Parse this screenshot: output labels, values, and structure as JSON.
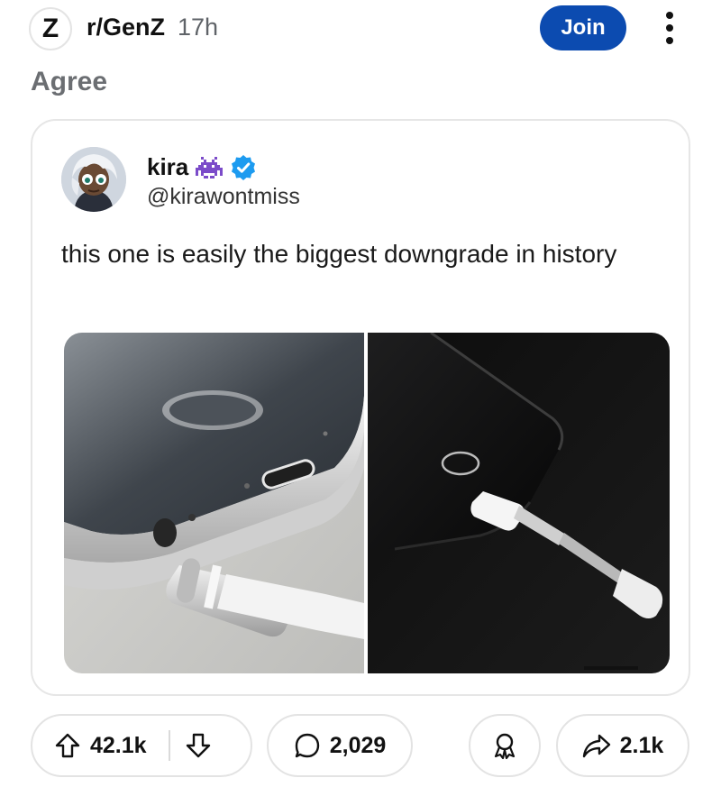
{
  "header": {
    "subreddit_letter": "Z",
    "subreddit": "r/GenZ",
    "time": "17h",
    "join_label": "Join",
    "more_icon": "more-vertical-icon"
  },
  "post": {
    "title": "Agree"
  },
  "tweet": {
    "display_name": "kira",
    "handle": "@kirawontmiss",
    "text": "this one is easily the biggest downgrade in history",
    "name_emoji_icon": "space-invader-icon",
    "verified_icon": "verified-badge-icon",
    "verified_color": "#1d9bf0",
    "media": {
      "left_image": "silver iPhone with headphone jack and 3.5mm audio plug",
      "right_image": "black iPhone with lightning to headphone adapter"
    }
  },
  "actions": {
    "upvotes": "42.1k",
    "comments": "2,029",
    "shares": "2.1k",
    "upvote_icon": "arrow-up-icon",
    "downvote_icon": "arrow-down-icon",
    "comment_icon": "comment-bubble-icon",
    "award_icon": "award-icon",
    "share_icon": "share-arrow-icon"
  },
  "colors": {
    "join_button": "#0c4bb0",
    "title_gray": "#6b6e72"
  }
}
